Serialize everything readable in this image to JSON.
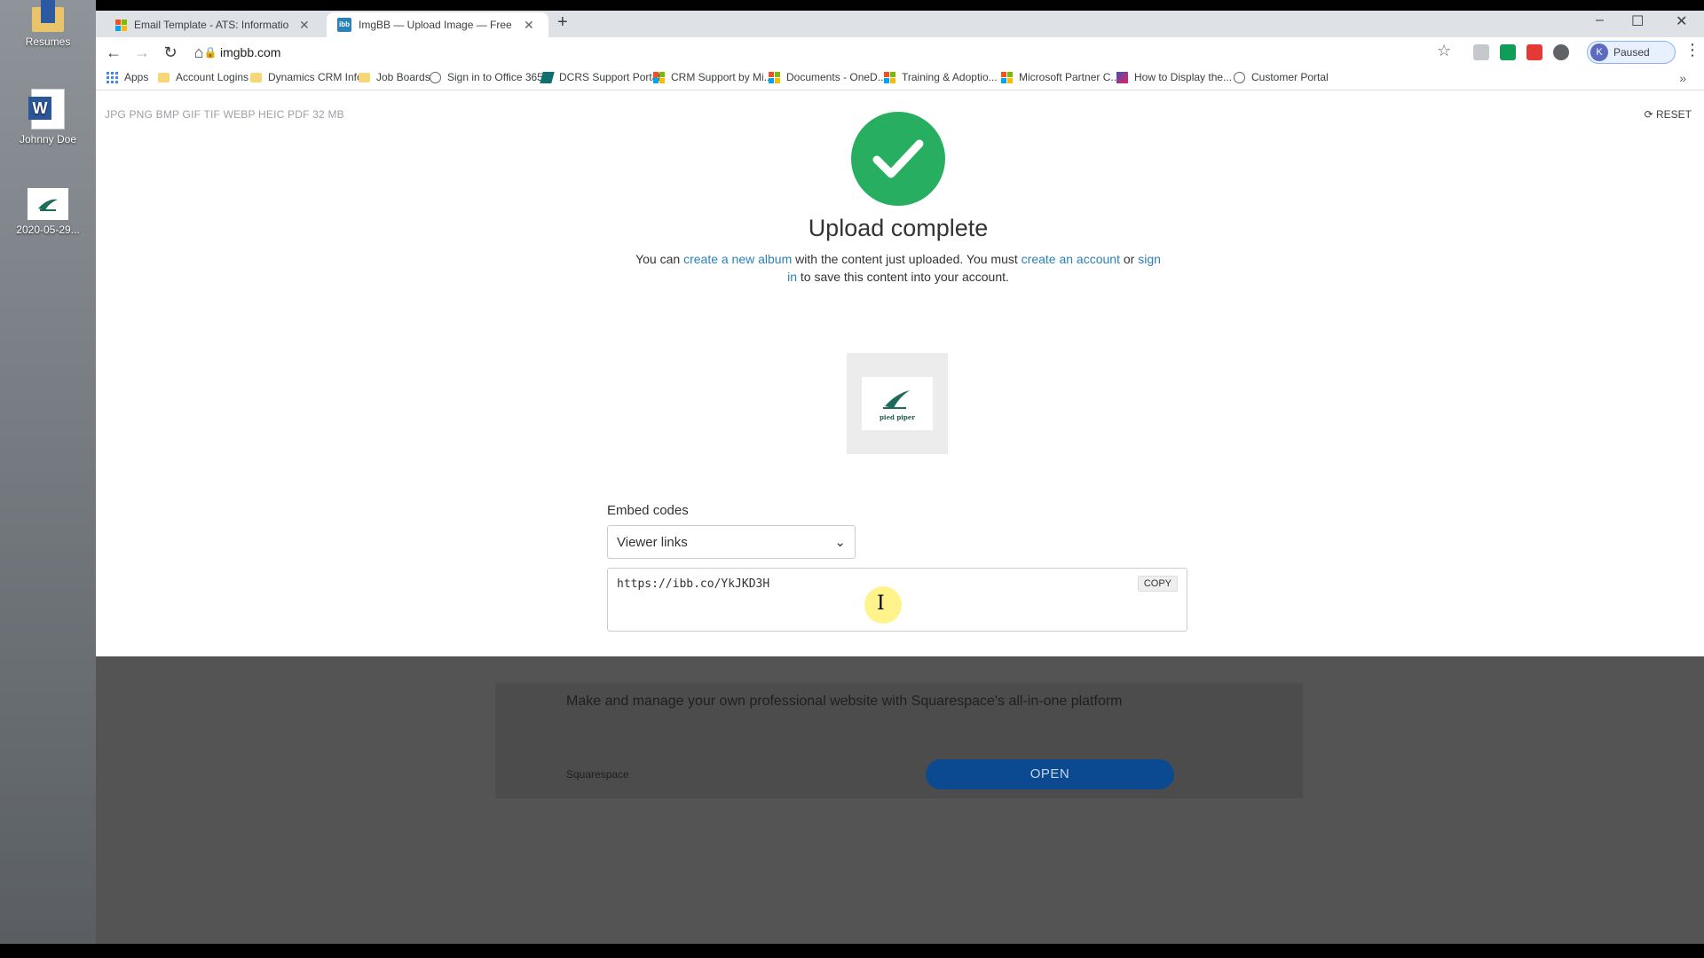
{
  "desktop": {
    "icons": [
      {
        "label": "Resumes",
        "icon": "folder-icon"
      },
      {
        "label": "Johnny Doe",
        "icon": "word-doc-icon"
      },
      {
        "label": "2020-05-29...",
        "icon": "image-file-icon"
      }
    ]
  },
  "browser": {
    "tabs": [
      {
        "title": "Email Template - ATS: Informatio",
        "icon": "microsoft-icon"
      },
      {
        "title": "ImgBB — Upload Image — Free",
        "icon": "imgbb-icon",
        "active": true
      }
    ],
    "new_tab": "+",
    "address": "imgbb.com",
    "profile_initial": "K",
    "profile_status": "Paused",
    "bookmarks": [
      {
        "label": "Apps",
        "icon": "apps-grid-icon"
      },
      {
        "label": "Account Logins",
        "icon": "folder-icon"
      },
      {
        "label": "Dynamics CRM Info",
        "icon": "folder-icon"
      },
      {
        "label": "Job Boards",
        "icon": "folder-icon"
      },
      {
        "label": "Sign in to Office 365",
        "icon": "globe-icon"
      },
      {
        "label": "DCRS Support Portal",
        "icon": "dynamics-icon"
      },
      {
        "label": "CRM Support by Mi...",
        "icon": "microsoft-icon"
      },
      {
        "label": "Documents - OneD...",
        "icon": "microsoft-icon"
      },
      {
        "label": "Training & Adoptio...",
        "icon": "microsoft-icon"
      },
      {
        "label": "Microsoft Partner C...",
        "icon": "microsoft-icon"
      },
      {
        "label": "How to Display the...",
        "icon": "chart-icon"
      },
      {
        "label": "Customer Portal",
        "icon": "globe-icon"
      }
    ],
    "bookmarks_more": "»"
  },
  "page": {
    "formats": "JPG PNG BMP GIF TIF WEBP HEIC PDF  32 MB",
    "reset": "RESET",
    "title": "Upload complete",
    "message": {
      "p1": "You can ",
      "link1": "create a new album",
      "p2": " with the content just uploaded. You must ",
      "link2": "create an account",
      "p3": " or ",
      "link3a": "sign",
      "link3b": "in",
      "p4": " to save this content into your account."
    },
    "preview_logo_text": "pied piper",
    "embed_label": "Embed codes",
    "embed_select_value": "Viewer links",
    "embed_code": "https://ibb.co/YkJKD3H",
    "copy_label": "COPY"
  },
  "ad": {
    "text": "Make and manage your own professional website with Squarespace's all-in-one platform",
    "source": "Squarespace",
    "open_label": "OPEN"
  },
  "colors": {
    "success": "#27ae60",
    "link": "#2a80b9",
    "ad_button": "#0b4a90"
  }
}
